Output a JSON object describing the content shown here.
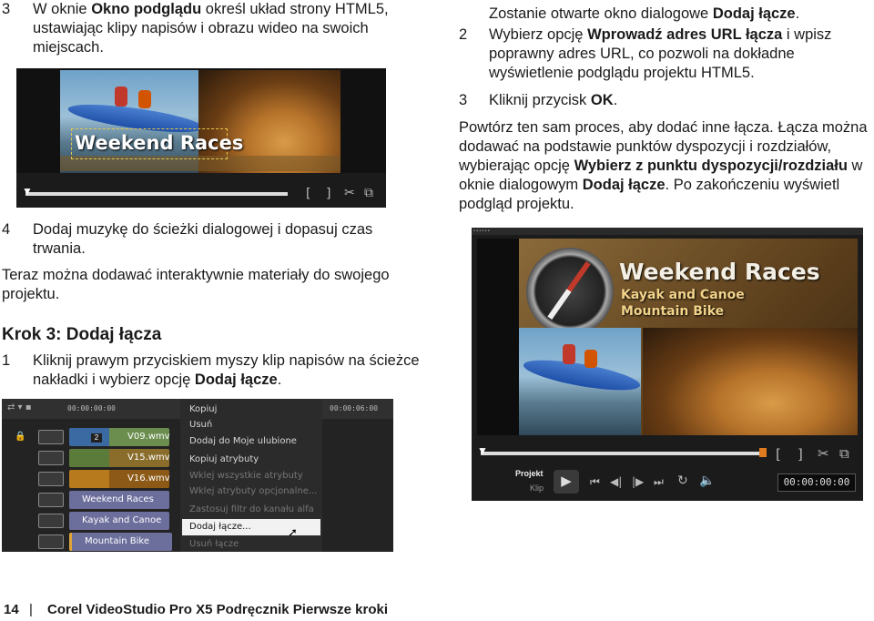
{
  "left": {
    "step3_num": "3",
    "step3_text_a": "W oknie ",
    "step3_bold": "Okno podglądu",
    "step3_text_b": " określ układ strony HTML5, ustawiając klipy napisów i obrazu wideo na swoich miejscach.",
    "preview_title": "Weekend Races",
    "step4_num": "4",
    "step4_text": "Dodaj muzykę do ścieżki dialogowej i dopasuj czas trwania.",
    "para": "Teraz można dodawać interaktywnie materiały do swojego projektu.",
    "heading": "Krok 3: Dodaj łącza",
    "step1_num": "1",
    "step1_text_a": "Kliknij prawym przyciskiem myszy klip napisów na ścieżce nakładki i wybierz opcję ",
    "step1_bold": "Dodaj łącze",
    "step1_text_b": "."
  },
  "timeline": {
    "timecode_left": "00:00:00:00",
    "timecode_right": "00:00:06:00",
    "clips": [
      "V09.wmv",
      "V15.wmv",
      "V16.wmv"
    ],
    "clip_badge": "2",
    "titles": [
      "Weekend Races",
      "Kayak and Canoe",
      "Mountain Bike"
    ],
    "menu": [
      {
        "label": "Kopiuj",
        "disabled": false
      },
      {
        "label": "Usuń",
        "disabled": false
      },
      {
        "label": "Dodaj do Moje ulubione",
        "disabled": false
      },
      {
        "label": "Kopiuj atrybuty",
        "disabled": false
      },
      {
        "label": "Wklej wszystkie atrybuty",
        "disabled": true
      },
      {
        "label": "Wklej atrybuty opcjonalne...",
        "disabled": true
      },
      {
        "label": "Zastosuj filtr do kanału alfa",
        "disabled": true
      },
      {
        "label": "Dodaj łącze...",
        "disabled": false
      },
      {
        "label": "Usuń łącze",
        "disabled": true
      }
    ]
  },
  "right": {
    "intro_a": "Zostanie otwarte okno dialogowe ",
    "intro_bold": "Dodaj łącze",
    "intro_b": ".",
    "step2_num": "2",
    "step2_a": "Wybierz opcję ",
    "step2_bold": "Wprowadź adres URL łącza",
    "step2_b": " i wpisz poprawny adres URL, co pozwoli na dokładne wyświetlenie podglądu projektu HTML5.",
    "step3_num": "3",
    "step3_a": "Kliknij przycisk ",
    "step3_bold": "OK",
    "step3_b": ".",
    "para_a": "Powtórz ten sam proces, aby dodać inne łącza. Łącza można dodawać na podstawie punktów dyspozycji i rozdziałów, wybierając opcję ",
    "para_bold1": "Wybierz z punktu dyspozycji/rozdziału",
    "para_b": " w oknie dialogowym ",
    "para_bold2": "Dodaj łącze",
    "para_c": ". Po zakończeniu wyświetl podgląd projektu.",
    "preview_titles": [
      "Weekend Races",
      "Kayak and Canoe",
      "Mountain Bike"
    ],
    "mode_project": "Projekt",
    "mode_clip": "Klip",
    "timecode": "00:00:00:00"
  },
  "footer": {
    "page": "14",
    "separator": "|",
    "title": "Corel VideoStudio Pro X5 Podręcznik Pierwsze kroki"
  }
}
